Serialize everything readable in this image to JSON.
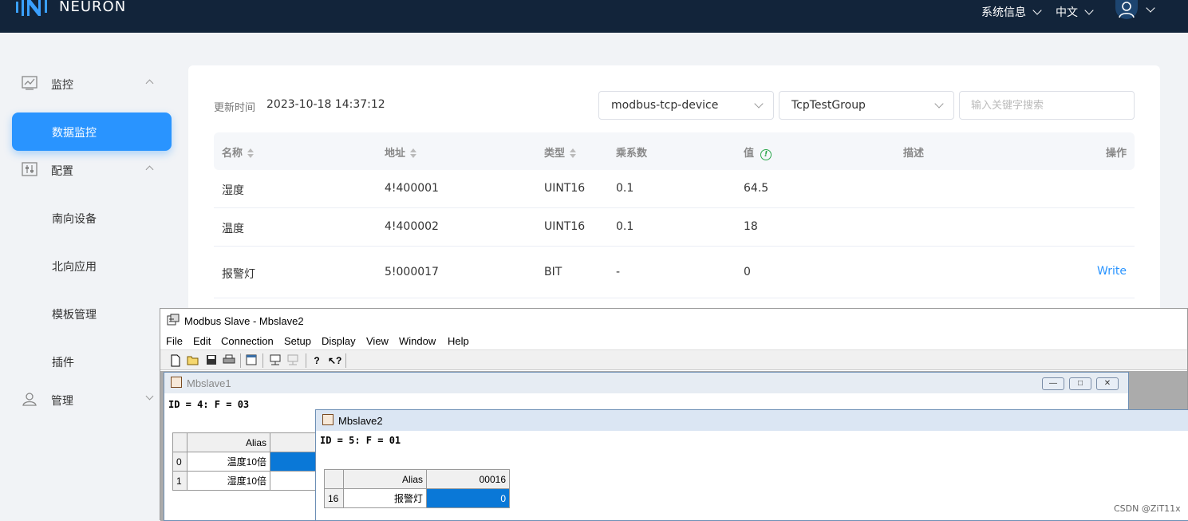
{
  "app": {
    "brand": "NEURON"
  },
  "header": {
    "system_info": "系统信息",
    "language": "中文"
  },
  "sidebar": {
    "groups": [
      {
        "label": "监控",
        "icon": "monitor-chart-icon"
      },
      {
        "label": "配置",
        "icon": "config-sliders-icon"
      },
      {
        "label": "管理",
        "icon": "user-icon"
      }
    ],
    "items": [
      {
        "label": "数据监控",
        "active": true
      },
      {
        "label": "南向设备"
      },
      {
        "label": "北向应用"
      },
      {
        "label": "模板管理"
      },
      {
        "label": "插件"
      }
    ]
  },
  "main": {
    "update_label": "更新时间",
    "update_time": "2023-10-18 14:37:12",
    "device_select": "modbus-tcp-device",
    "group_select": "TcpTestGroup",
    "search_placeholder": "输入关键字搜索",
    "columns": [
      "名称",
      "地址",
      "类型",
      "乘系数",
      "值",
      "描述",
      "操作"
    ],
    "rows": [
      {
        "name": "湿度",
        "address": "4!400001",
        "type": "UINT16",
        "multiplier": "0.1",
        "value": "64.5",
        "desc": "",
        "action": ""
      },
      {
        "name": "温度",
        "address": "4!400002",
        "type": "UINT16",
        "multiplier": "0.1",
        "value": "18",
        "desc": "",
        "action": ""
      },
      {
        "name": "报警灯",
        "address": "5!000017",
        "type": "BIT",
        "multiplier": "-",
        "value": "0",
        "desc": "",
        "action": "Write"
      }
    ]
  },
  "modbus": {
    "title": "Modbus Slave - Mbslave2",
    "menu": [
      "File",
      "Edit",
      "Connection",
      "Setup",
      "Display",
      "View",
      "Window",
      "Help"
    ],
    "win1": {
      "title": "Mbslave1",
      "header": "ID = 4: F = 03",
      "alias_col": "Alias",
      "rows": [
        {
          "idx": "0",
          "alias": "温度10倍"
        },
        {
          "idx": "1",
          "alias": "湿度10倍"
        }
      ]
    },
    "win2": {
      "title": "Mbslave2",
      "header": "ID = 5: F = 01",
      "alias_col": "Alias",
      "addr_col": "00016",
      "rows": [
        {
          "idx": "16",
          "alias": "报警灯",
          "value": "0"
        }
      ]
    }
  },
  "watermark": "CSDN @ZiT11x",
  "colors": {
    "topbar": "#12243a",
    "accent": "#2994ff",
    "selected_cell": "#0a78d7"
  }
}
